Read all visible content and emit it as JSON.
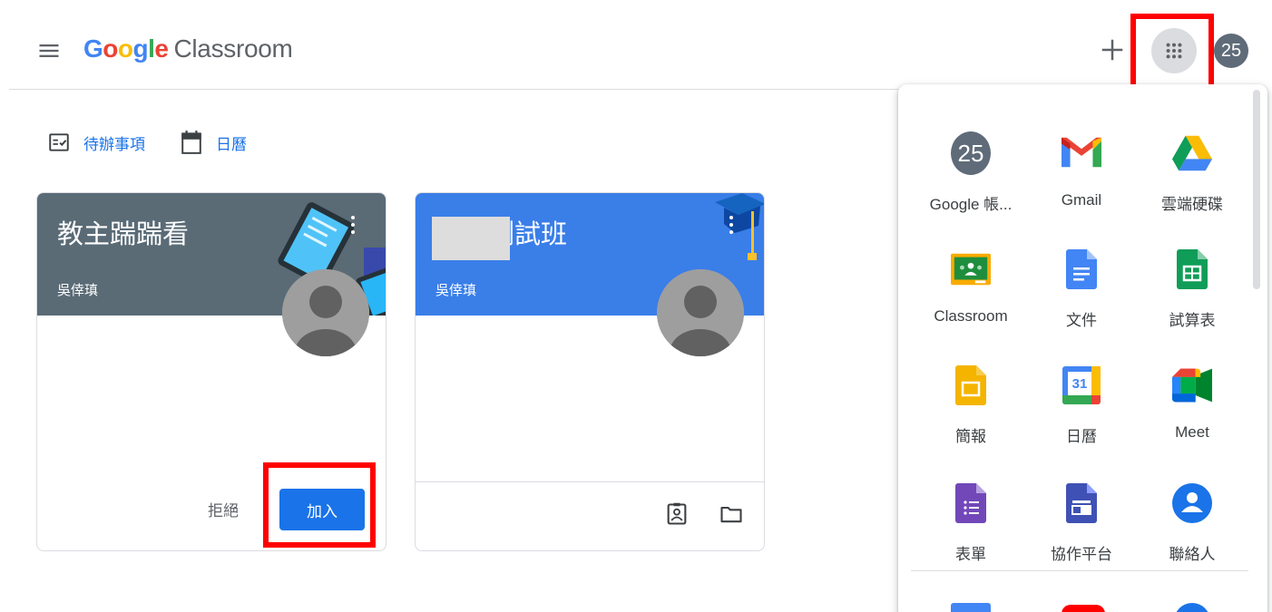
{
  "header": {
    "logo_google": [
      "G",
      "o",
      "o",
      "g",
      "l",
      "e"
    ],
    "logo_colors": [
      "#4285F4",
      "#EA4335",
      "#FBBC05",
      "#4285F4",
      "#34A853",
      "#EA4335"
    ],
    "logo_product": "Classroom",
    "account_initials": "25"
  },
  "subnav": {
    "todo_label": "待辦事項",
    "calendar_label": "日曆"
  },
  "cards": [
    {
      "title": "教主踹踹看",
      "teacher": "吳倖瑱",
      "header_color": "#5a6b76",
      "decline_label": "拒絕",
      "join_label": "加入"
    },
    {
      "title": "敦…讀測試班",
      "title_visible_suffix": "測試班",
      "teacher": "吳倖瑱",
      "header_color": "#3a7ee8"
    }
  ],
  "apps_panel": {
    "apps": [
      {
        "label": "Google 帳...",
        "icon": "account-icon",
        "initials": "25"
      },
      {
        "label": "Gmail",
        "icon": "gmail-icon"
      },
      {
        "label": "雲端硬碟",
        "icon": "drive-icon"
      },
      {
        "label": "Classroom",
        "icon": "classroom-icon"
      },
      {
        "label": "文件",
        "icon": "docs-icon"
      },
      {
        "label": "試算表",
        "icon": "sheets-icon"
      },
      {
        "label": "簡報",
        "icon": "slides-icon"
      },
      {
        "label": "日曆",
        "icon": "calendar-icon",
        "day": "31"
      },
      {
        "label": "Meet",
        "icon": "meet-icon"
      },
      {
        "label": "表單",
        "icon": "forms-icon"
      },
      {
        "label": "協作平台",
        "icon": "sites-icon"
      },
      {
        "label": "聯絡人",
        "icon": "contacts-icon"
      }
    ]
  },
  "colors": {
    "accent": "#1a73e8",
    "highlight": "#ff0000"
  }
}
